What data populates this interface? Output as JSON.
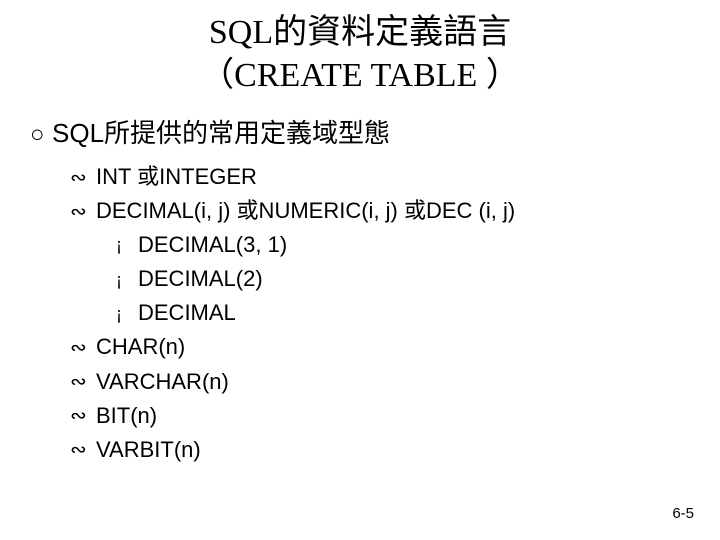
{
  "title_line1": "SQL的資料定義語言",
  "title_line2": "（CREATE TABLE ）",
  "heading": "SQL所提供的常用定義域型態",
  "items": [
    {
      "level": 2,
      "text": "INT 或INTEGER"
    },
    {
      "level": 2,
      "text": "DECIMAL(i, j) 或NUMERIC(i, j) 或DEC (i, j)"
    },
    {
      "level": 3,
      "text": "DECIMAL(3, 1)"
    },
    {
      "level": 3,
      "text": "DECIMAL(2)"
    },
    {
      "level": 3,
      "text": "DECIMAL"
    },
    {
      "level": 2,
      "text": "CHAR(n)"
    },
    {
      "level": 2,
      "text": "VARCHAR(n)"
    },
    {
      "level": 2,
      "text": "BIT(n)"
    },
    {
      "level": 2,
      "text": "VARBIT(n)"
    }
  ],
  "bullets": {
    "level1": "○",
    "level2": "∾",
    "level3": "¡"
  },
  "page_number": "6-5"
}
